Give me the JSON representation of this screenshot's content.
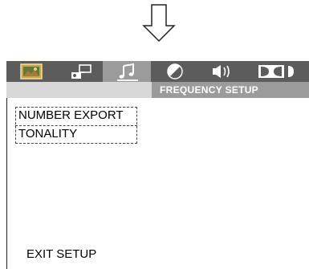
{
  "tabs": [
    {
      "icon": "picture-icon",
      "active": false
    },
    {
      "icon": "projector-icon",
      "active": false
    },
    {
      "icon": "music-note-icon",
      "active": true
    },
    {
      "icon": "contrast-icon",
      "active": false
    },
    {
      "icon": "speaker-icon",
      "active": false
    },
    {
      "icon": "dolby-icon",
      "active": false
    }
  ],
  "header": {
    "title": "FREQUENCY SETUP"
  },
  "menu": {
    "items": [
      "NUMBER EXPORT",
      "TONALITY"
    ]
  },
  "footer": {
    "exit_label": "EXIT SETUP"
  },
  "colors": {
    "tabbar": "#5c5c5c",
    "active_tab": "#9b9b9b",
    "header_left": "#d7d7d7",
    "header_right": "#9b9b9b"
  }
}
